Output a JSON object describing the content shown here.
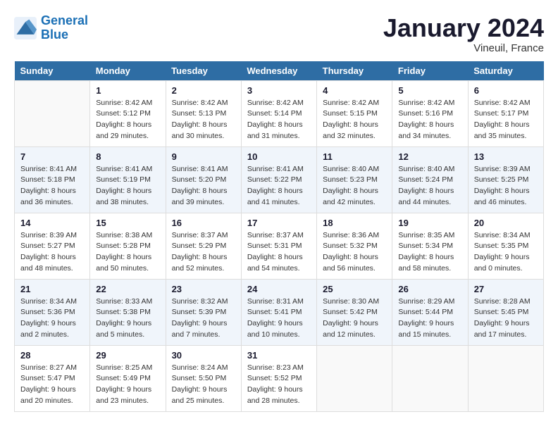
{
  "header": {
    "logo_line1": "General",
    "logo_line2": "Blue",
    "month_title": "January 2024",
    "location": "Vineuil, France"
  },
  "weekdays": [
    "Sunday",
    "Monday",
    "Tuesday",
    "Wednesday",
    "Thursday",
    "Friday",
    "Saturday"
  ],
  "weeks": [
    [
      {
        "day": "",
        "sunrise": "",
        "sunset": "",
        "daylight": ""
      },
      {
        "day": "1",
        "sunrise": "Sunrise: 8:42 AM",
        "sunset": "Sunset: 5:12 PM",
        "daylight": "Daylight: 8 hours and 29 minutes."
      },
      {
        "day": "2",
        "sunrise": "Sunrise: 8:42 AM",
        "sunset": "Sunset: 5:13 PM",
        "daylight": "Daylight: 8 hours and 30 minutes."
      },
      {
        "day": "3",
        "sunrise": "Sunrise: 8:42 AM",
        "sunset": "Sunset: 5:14 PM",
        "daylight": "Daylight: 8 hours and 31 minutes."
      },
      {
        "day": "4",
        "sunrise": "Sunrise: 8:42 AM",
        "sunset": "Sunset: 5:15 PM",
        "daylight": "Daylight: 8 hours and 32 minutes."
      },
      {
        "day": "5",
        "sunrise": "Sunrise: 8:42 AM",
        "sunset": "Sunset: 5:16 PM",
        "daylight": "Daylight: 8 hours and 34 minutes."
      },
      {
        "day": "6",
        "sunrise": "Sunrise: 8:42 AM",
        "sunset": "Sunset: 5:17 PM",
        "daylight": "Daylight: 8 hours and 35 minutes."
      }
    ],
    [
      {
        "day": "7",
        "sunrise": "Sunrise: 8:41 AM",
        "sunset": "Sunset: 5:18 PM",
        "daylight": "Daylight: 8 hours and 36 minutes."
      },
      {
        "day": "8",
        "sunrise": "Sunrise: 8:41 AM",
        "sunset": "Sunset: 5:19 PM",
        "daylight": "Daylight: 8 hours and 38 minutes."
      },
      {
        "day": "9",
        "sunrise": "Sunrise: 8:41 AM",
        "sunset": "Sunset: 5:20 PM",
        "daylight": "Daylight: 8 hours and 39 minutes."
      },
      {
        "day": "10",
        "sunrise": "Sunrise: 8:41 AM",
        "sunset": "Sunset: 5:22 PM",
        "daylight": "Daylight: 8 hours and 41 minutes."
      },
      {
        "day": "11",
        "sunrise": "Sunrise: 8:40 AM",
        "sunset": "Sunset: 5:23 PM",
        "daylight": "Daylight: 8 hours and 42 minutes."
      },
      {
        "day": "12",
        "sunrise": "Sunrise: 8:40 AM",
        "sunset": "Sunset: 5:24 PM",
        "daylight": "Daylight: 8 hours and 44 minutes."
      },
      {
        "day": "13",
        "sunrise": "Sunrise: 8:39 AM",
        "sunset": "Sunset: 5:25 PM",
        "daylight": "Daylight: 8 hours and 46 minutes."
      }
    ],
    [
      {
        "day": "14",
        "sunrise": "Sunrise: 8:39 AM",
        "sunset": "Sunset: 5:27 PM",
        "daylight": "Daylight: 8 hours and 48 minutes."
      },
      {
        "day": "15",
        "sunrise": "Sunrise: 8:38 AM",
        "sunset": "Sunset: 5:28 PM",
        "daylight": "Daylight: 8 hours and 50 minutes."
      },
      {
        "day": "16",
        "sunrise": "Sunrise: 8:37 AM",
        "sunset": "Sunset: 5:29 PM",
        "daylight": "Daylight: 8 hours and 52 minutes."
      },
      {
        "day": "17",
        "sunrise": "Sunrise: 8:37 AM",
        "sunset": "Sunset: 5:31 PM",
        "daylight": "Daylight: 8 hours and 54 minutes."
      },
      {
        "day": "18",
        "sunrise": "Sunrise: 8:36 AM",
        "sunset": "Sunset: 5:32 PM",
        "daylight": "Daylight: 8 hours and 56 minutes."
      },
      {
        "day": "19",
        "sunrise": "Sunrise: 8:35 AM",
        "sunset": "Sunset: 5:34 PM",
        "daylight": "Daylight: 8 hours and 58 minutes."
      },
      {
        "day": "20",
        "sunrise": "Sunrise: 8:34 AM",
        "sunset": "Sunset: 5:35 PM",
        "daylight": "Daylight: 9 hours and 0 minutes."
      }
    ],
    [
      {
        "day": "21",
        "sunrise": "Sunrise: 8:34 AM",
        "sunset": "Sunset: 5:36 PM",
        "daylight": "Daylight: 9 hours and 2 minutes."
      },
      {
        "day": "22",
        "sunrise": "Sunrise: 8:33 AM",
        "sunset": "Sunset: 5:38 PM",
        "daylight": "Daylight: 9 hours and 5 minutes."
      },
      {
        "day": "23",
        "sunrise": "Sunrise: 8:32 AM",
        "sunset": "Sunset: 5:39 PM",
        "daylight": "Daylight: 9 hours and 7 minutes."
      },
      {
        "day": "24",
        "sunrise": "Sunrise: 8:31 AM",
        "sunset": "Sunset: 5:41 PM",
        "daylight": "Daylight: 9 hours and 10 minutes."
      },
      {
        "day": "25",
        "sunrise": "Sunrise: 8:30 AM",
        "sunset": "Sunset: 5:42 PM",
        "daylight": "Daylight: 9 hours and 12 minutes."
      },
      {
        "day": "26",
        "sunrise": "Sunrise: 8:29 AM",
        "sunset": "Sunset: 5:44 PM",
        "daylight": "Daylight: 9 hours and 15 minutes."
      },
      {
        "day": "27",
        "sunrise": "Sunrise: 8:28 AM",
        "sunset": "Sunset: 5:45 PM",
        "daylight": "Daylight: 9 hours and 17 minutes."
      }
    ],
    [
      {
        "day": "28",
        "sunrise": "Sunrise: 8:27 AM",
        "sunset": "Sunset: 5:47 PM",
        "daylight": "Daylight: 9 hours and 20 minutes."
      },
      {
        "day": "29",
        "sunrise": "Sunrise: 8:25 AM",
        "sunset": "Sunset: 5:49 PM",
        "daylight": "Daylight: 9 hours and 23 minutes."
      },
      {
        "day": "30",
        "sunrise": "Sunrise: 8:24 AM",
        "sunset": "Sunset: 5:50 PM",
        "daylight": "Daylight: 9 hours and 25 minutes."
      },
      {
        "day": "31",
        "sunrise": "Sunrise: 8:23 AM",
        "sunset": "Sunset: 5:52 PM",
        "daylight": "Daylight: 9 hours and 28 minutes."
      },
      {
        "day": "",
        "sunrise": "",
        "sunset": "",
        "daylight": ""
      },
      {
        "day": "",
        "sunrise": "",
        "sunset": "",
        "daylight": ""
      },
      {
        "day": "",
        "sunrise": "",
        "sunset": "",
        "daylight": ""
      }
    ]
  ]
}
